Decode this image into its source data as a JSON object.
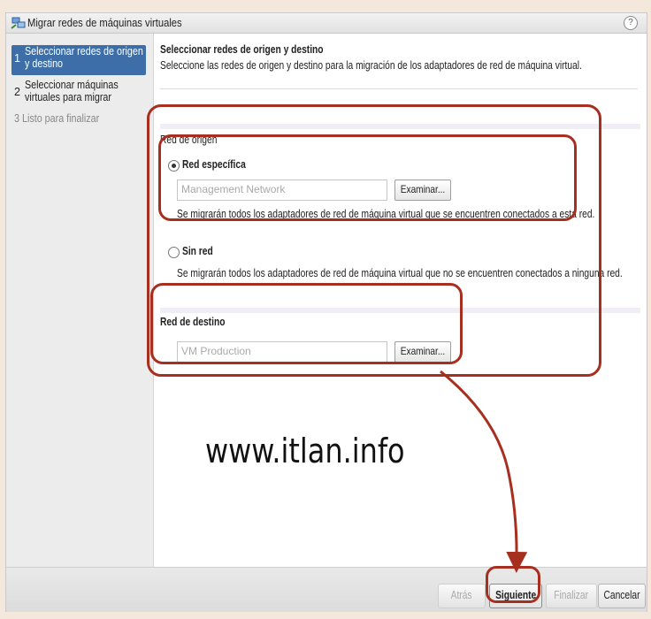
{
  "window": {
    "title": "Migrar redes de máquinas virtuales",
    "help": "?"
  },
  "steps": [
    {
      "num": "1",
      "label_line1": "Seleccionar redes de origen",
      "label_line2": "y destino"
    },
    {
      "num": "2",
      "label_line1": "Seleccionar máquinas",
      "label_line2": "virtuales para migrar"
    },
    {
      "num": "3",
      "label_line1": "Listo para finalizar"
    }
  ],
  "main": {
    "title": "Seleccionar redes de origen y destino",
    "subtitle": "Seleccione las redes de origen y destino para la migración de los adaptadores de red de máquina virtual.",
    "source": {
      "heading": "Red de origen",
      "specific": {
        "label": "Red específica",
        "placeholder": "Management Network",
        "browse": "Examinar...",
        "description": "Se migrarán todos los adaptadores de red de máquina virtual que se encuentren conectados a esta red."
      },
      "none": {
        "label": "Sin red",
        "description": "Se migrarán todos los adaptadores de red de máquina virtual que no se encuentren conectados a ninguna red."
      }
    },
    "destination": {
      "heading": "Red de destino",
      "placeholder": "VM Production",
      "browse": "Examinar..."
    }
  },
  "footer": {
    "back": "Atrás",
    "next": "Siguiente",
    "finish": "Finalizar",
    "cancel": "Cancelar"
  },
  "watermark": "www.itlan.info",
  "colors": {
    "accent": "#3d6ea7",
    "annotation": "#a72f1f",
    "page_background": "#f4e8dd"
  }
}
